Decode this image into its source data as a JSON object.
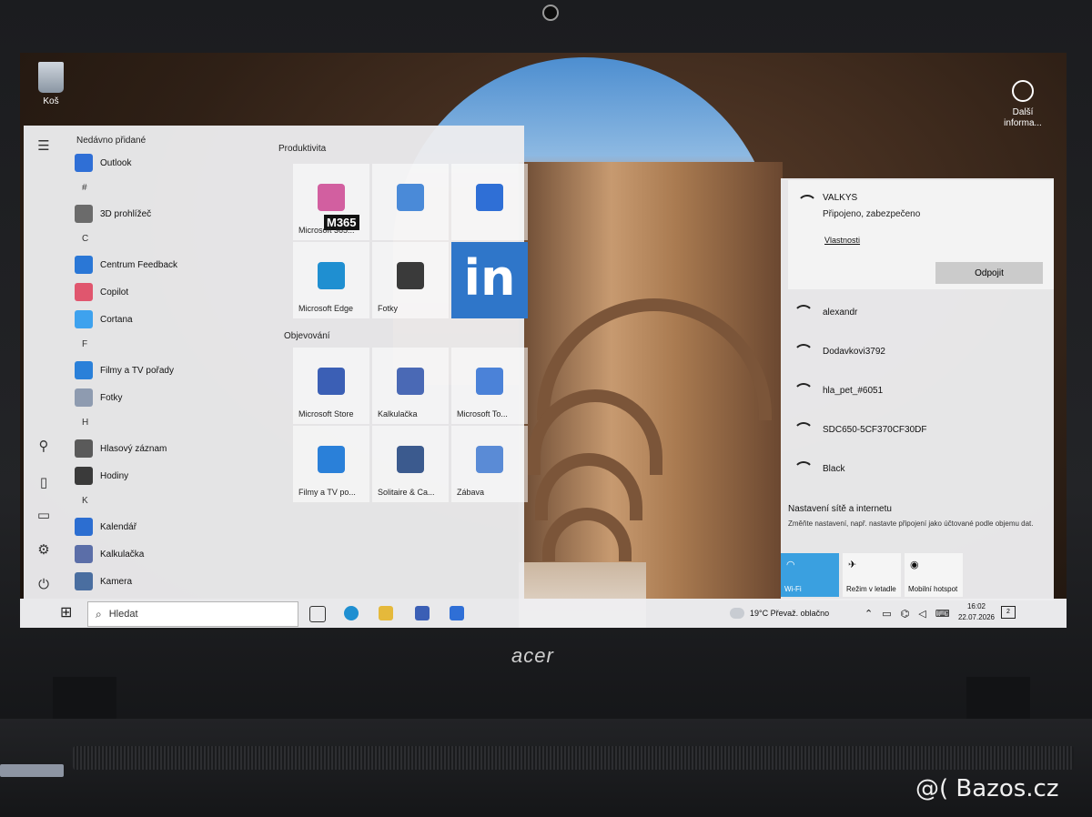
{
  "desktop": {
    "recycle_bin_label": "Koš",
    "more_info_label": "Další informa..."
  },
  "start_menu": {
    "recently_added_label": "Nedávno přidané",
    "app_list": [
      {
        "type": "app",
        "label": "Outlook",
        "icon": "outlook-icon",
        "color": "#2f6fd6"
      },
      {
        "type": "letter",
        "label": "#"
      },
      {
        "type": "app",
        "label": "3D prohlížeč",
        "icon": "cube-icon",
        "color": "#6b6b6b"
      },
      {
        "type": "letter",
        "label": "C"
      },
      {
        "type": "app",
        "label": "Centrum Feedback",
        "icon": "feedback-icon",
        "color": "#2a77d6"
      },
      {
        "type": "app",
        "label": "Copilot",
        "icon": "copilot-icon",
        "color": "#e0566e"
      },
      {
        "type": "app",
        "label": "Cortana",
        "icon": "cortana-icon",
        "color": "#3ea2ee"
      },
      {
        "type": "letter",
        "label": "F"
      },
      {
        "type": "app",
        "label": "Filmy a TV pořady",
        "icon": "films-icon",
        "color": "#2a80d9"
      },
      {
        "type": "app",
        "label": "Fotky",
        "icon": "photos-icon",
        "color": "#8e9bb0"
      },
      {
        "type": "letter",
        "label": "H"
      },
      {
        "type": "app",
        "label": "Hlasový záznam",
        "icon": "microphone-icon",
        "color": "#5a5a5a"
      },
      {
        "type": "app",
        "label": "Hodiny",
        "icon": "clock-icon",
        "color": "#3a3a3a"
      },
      {
        "type": "letter",
        "label": "K"
      },
      {
        "type": "app",
        "label": "Kalendář",
        "icon": "calendar-icon",
        "color": "#2c6ed1"
      },
      {
        "type": "app",
        "label": "Kalkulačka",
        "icon": "calculator-icon",
        "color": "#5b6ea8"
      },
      {
        "type": "app",
        "label": "Kamera",
        "icon": "camera-icon",
        "color": "#4a6ea0"
      }
    ],
    "group_productivity": "Produktivita",
    "group_explore": "Objevování",
    "tiles": [
      {
        "label": "Microsoft 365...",
        "icon": "m365-icon",
        "badge": "M365",
        "color": "#d25fa0"
      },
      {
        "label": "",
        "icon": "office-apps-icon",
        "color": "#4a8ad8"
      },
      {
        "label": "",
        "icon": "outlook-icon",
        "color": "#2f6fd6"
      },
      {
        "label": "Microsoft Edge",
        "icon": "edge-icon",
        "color": "#1f8fd1"
      },
      {
        "label": "Fotky",
        "icon": "photos-icon",
        "color": "#3a3a3a"
      },
      {
        "label": "",
        "icon": "linkedin-icon",
        "glyph": "in",
        "color": "#2f76c9"
      },
      {
        "label": "Microsoft Store",
        "icon": "store-icon",
        "color": "#3b5fb5"
      },
      {
        "label": "Kalkulačka",
        "icon": "calculator-icon",
        "color": "#4a69b5"
      },
      {
        "label": "Microsoft To...",
        "icon": "todo-icon",
        "color": "#4b82d8"
      },
      {
        "label": "Filmy a TV po...",
        "icon": "films-icon",
        "color": "#2a80d9"
      },
      {
        "label": "Solitaire & Ca...",
        "icon": "solitaire-icon",
        "color": "#3b5a8e"
      },
      {
        "label": "Zábava",
        "icon": "entertainment-icon",
        "color": "#5a8bd6"
      }
    ]
  },
  "network": {
    "connected": {
      "ssid": "VALKYS",
      "status": "Připojeno, zabezpečeno",
      "properties": "Vlastnosti",
      "disconnect": "Odpojit"
    },
    "networks": [
      "alexandr",
      "Dodavkovi3792",
      "hla_pet_#6051",
      "SDC650-5CF370CF30DF",
      "Black"
    ],
    "settings_title": "Nastavení sítě a internetu",
    "settings_desc": "Změňte nastavení, např. nastavte připojení jako účtované podle objemu dat.",
    "quick_actions": [
      {
        "label": "Wi-Fi",
        "icon": "wifi-icon",
        "active": true
      },
      {
        "label": "Režim v letadle",
        "icon": "airplane-icon",
        "active": false
      },
      {
        "label": "Mobilní hotspot",
        "icon": "hotspot-icon",
        "active": false
      }
    ]
  },
  "taskbar": {
    "search_placeholder": "Hledat",
    "weather": "19°C  Převaž. oblačno",
    "time": "16:02",
    "date": "22.07.2026",
    "notification_count": "2"
  },
  "device": {
    "brand": "acer",
    "watermark": "@( Bazos.cz"
  }
}
